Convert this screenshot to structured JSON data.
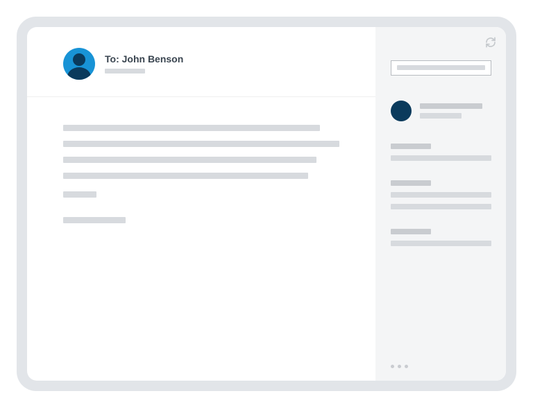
{
  "header": {
    "to_label": "To: John Benson"
  },
  "colors": {
    "avatar_bg": "#1893d6",
    "avatar_fg": "#0a3a5c",
    "placeholder": "#d7dade"
  }
}
